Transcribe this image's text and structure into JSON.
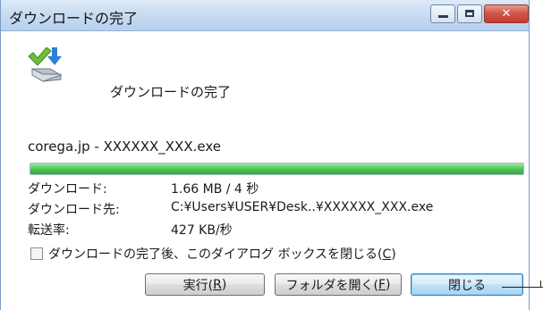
{
  "window": {
    "title": "ダウンロードの完了"
  },
  "header": {
    "message": "ダウンロードの完了"
  },
  "file": {
    "name": "corega.jp - XXXXXX_XXX.exe",
    "progress_fraction": 1.0
  },
  "info": {
    "rows": [
      {
        "label": "ダウンロード:",
        "value": "1.66 MB / 4 秒"
      },
      {
        "label": "ダウンロード先:",
        "value": "C:¥Users¥USER¥Desk..¥XXXXXX_XXX.exe"
      },
      {
        "label": "転送率:",
        "value": "427 KB/秒"
      }
    ]
  },
  "options": {
    "close_on_complete_prefix": "ダウンロードの完了後、このダイアログ ボックスを閉じる(",
    "close_on_complete_key": "C",
    "close_on_complete_suffix": ")",
    "checked": false
  },
  "buttons": {
    "run_prefix": "実行(",
    "run_key": "R",
    "run_suffix": ")",
    "open_folder_prefix": "フォルダを開く(",
    "open_folder_key": "F",
    "open_folder_suffix": ")",
    "close": "閉じる"
  },
  "icons": {
    "download_complete": "download-complete-icon",
    "minimize": "minimize-icon",
    "maximize": "maximize-icon",
    "close": "close-icon"
  },
  "colors": {
    "progress": "#4fc657",
    "close_button": "#c63b2d",
    "default_button_border": "#3c7fb1"
  }
}
